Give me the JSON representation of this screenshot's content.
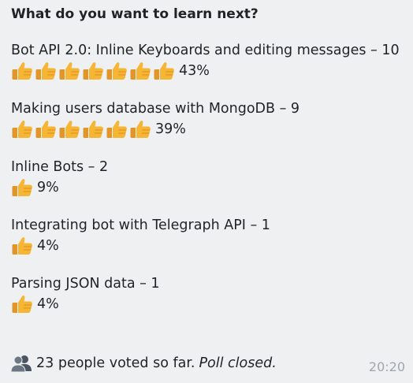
{
  "poll": {
    "title": "What do you want to learn next?",
    "options": [
      {
        "text": "Bot API 2.0: Inline Keyboards and editing messages – 10",
        "percent": "43%",
        "thumbs": 7
      },
      {
        "text": "Making users database with MongoDB – 9",
        "percent": "39%",
        "thumbs": 6
      },
      {
        "text": "Inline Bots – 2",
        "percent": "9%",
        "thumbs": 1
      },
      {
        "text": "Integrating bot with Telegraph API – 1",
        "percent": "4%",
        "thumbs": 1
      },
      {
        "text": "Parsing JSON data – 1",
        "percent": "4%",
        "thumbs": 1
      }
    ],
    "footer": {
      "voted_text": "23 people voted so far.",
      "closed_text": "Poll closed."
    },
    "time": "20:20"
  },
  "icons": {
    "vote": "thumbs-up-icon",
    "people": "people-icon"
  },
  "colors": {
    "background": "#eef0f2",
    "text": "#1f2326",
    "time": "#a0a7ad",
    "thumb": "#f6b532",
    "thumb_shade": "#e0962a"
  }
}
